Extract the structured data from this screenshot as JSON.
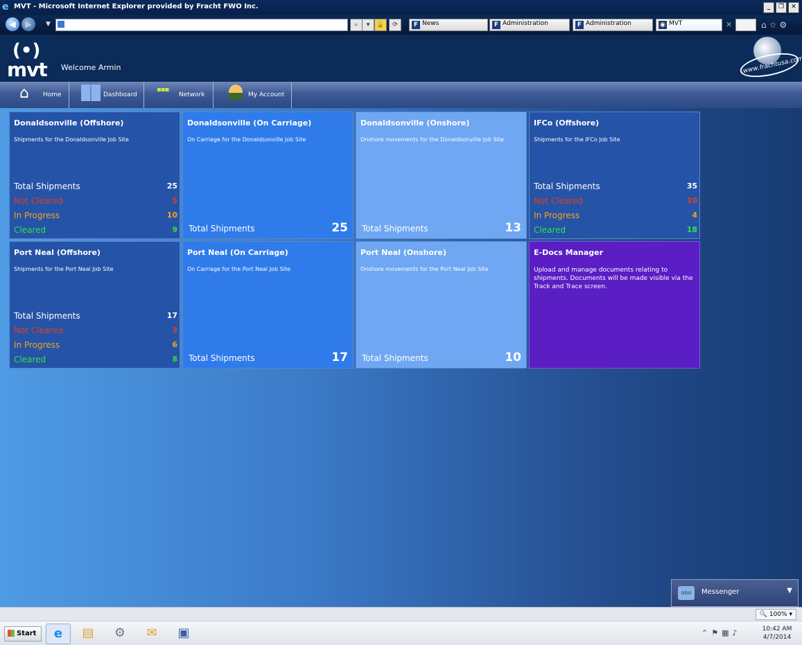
{
  "window": {
    "title": "MVT - Microsoft Internet Explorer provided by Fracht FWO Inc."
  },
  "browser": {
    "tabs": [
      {
        "label": "News"
      },
      {
        "label": "Administration"
      },
      {
        "label": "Administration"
      },
      {
        "label": "MVT"
      }
    ]
  },
  "header": {
    "logo_text": "mvt",
    "welcome": "Welcome Armin",
    "partner_url": "www.frachtusa.com"
  },
  "nav": [
    {
      "label": "Home",
      "icon": "home-icon"
    },
    {
      "label": "Dashboard",
      "icon": "dashboard-icon"
    },
    {
      "label": "Network",
      "icon": "network-icon"
    },
    {
      "label": "My Account",
      "icon": "account-icon"
    }
  ],
  "colors": {
    "offshore": "#2553a8",
    "carriage": "#2f7bea",
    "onshore": "#70a7f3",
    "edocs": "#5a1ec4",
    "not_cleared": "#e0411f",
    "in_progress": "#f2a516",
    "cleared": "#2fe04a"
  },
  "tiles": {
    "don_off": {
      "title": "Donaldsonville (Offshore)",
      "subtitle": "Shipments for the Donaldsonville Job Site",
      "stats": {
        "total_label": "Total Shipments",
        "total": "25",
        "not_cleared_label": "Not Cleared",
        "not_cleared": "5",
        "in_progress_label": "In Progress",
        "in_progress": "10",
        "cleared_label": "Cleared",
        "cleared": "9"
      }
    },
    "don_car": {
      "title": "Donaldsonville (On Carriage)",
      "subtitle": "On Carriage for the Donaldsonville Job Site",
      "total_label": "Total Shipments",
      "total": "25"
    },
    "don_on": {
      "title": "Donaldsonville (Onshore)",
      "subtitle": "Onshore movements for the Donaldsonville Job Site",
      "total_label": "Total Shipments",
      "total": "13"
    },
    "ifco_off": {
      "title": "IFCo (Offshore)",
      "subtitle": "Shipments for the IFCo Job Site",
      "stats": {
        "total_label": "Total Shipments",
        "total": "35",
        "not_cleared_label": "Not Cleared",
        "not_cleared": "10",
        "in_progress_label": "In Progress",
        "in_progress": "4",
        "cleared_label": "Cleared",
        "cleared": "18"
      }
    },
    "pn_off": {
      "title": "Port Neal (Offshore)",
      "subtitle": "Shipments for the Port Neal Job Site",
      "stats": {
        "total_label": "Total Shipments",
        "total": "17",
        "not_cleared_label": "Not Cleared",
        "not_cleared": "3",
        "in_progress_label": "In Progress",
        "in_progress": "6",
        "cleared_label": "Cleared",
        "cleared": "8"
      }
    },
    "pn_car": {
      "title": "Port Neal (On Carriage)",
      "subtitle": "On Carriage for the Port Neal Job Site",
      "total_label": "Total Shipments",
      "total": "17"
    },
    "pn_on": {
      "title": "Port Neal (Onshore)",
      "subtitle": "Onshore movements for the Port Neal Job Site",
      "total_label": "Total Shipments",
      "total": "10"
    },
    "edocs": {
      "title": "E-Docs Manager",
      "description": "Upload and manage documents relating to shipments. Documents will be made visible via the Track and Trace screen."
    }
  },
  "messenger": {
    "label": "Messenger"
  },
  "statusbar": {
    "zoom": "100%"
  },
  "taskbar": {
    "start": "Start",
    "time": "10:42 AM",
    "date": "4/7/2014"
  }
}
